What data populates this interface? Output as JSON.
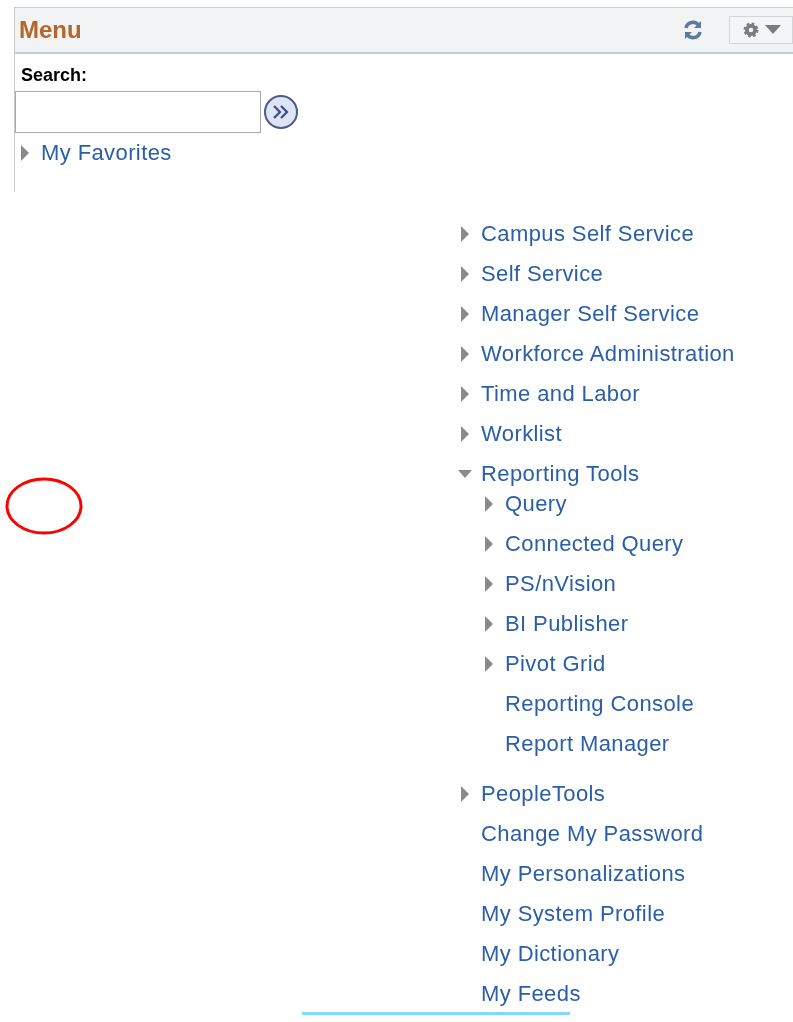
{
  "panel": {
    "title": "Menu"
  },
  "search": {
    "label": "Search:"
  },
  "favorites": {
    "label": "My Favorites",
    "kind": "folder",
    "expanded": false
  },
  "menu": [
    {
      "label": "Campus Self Service",
      "kind": "folder",
      "expanded": false
    },
    {
      "label": "Self Service",
      "kind": "folder",
      "expanded": false
    },
    {
      "label": "Manager Self Service",
      "kind": "folder",
      "expanded": false
    },
    {
      "label": "Workforce Administration",
      "kind": "folder",
      "expanded": false
    },
    {
      "label": "Time and Labor",
      "kind": "folder",
      "expanded": false
    },
    {
      "label": "Worklist",
      "kind": "folder",
      "expanded": false
    },
    {
      "label": "Reporting Tools",
      "kind": "folder",
      "expanded": true,
      "children": [
        {
          "label": "Query",
          "kind": "folder",
          "expanded": false
        },
        {
          "label": "Connected Query",
          "kind": "folder",
          "expanded": false
        },
        {
          "label": "PS/nVision",
          "kind": "folder",
          "expanded": false
        },
        {
          "label": "BI Publisher",
          "kind": "folder",
          "expanded": false
        },
        {
          "label": "Pivot Grid",
          "kind": "folder",
          "expanded": false
        },
        {
          "label": "Reporting Console",
          "kind": "link"
        },
        {
          "label": "Report Manager",
          "kind": "link"
        }
      ]
    },
    {
      "label": "PeopleTools",
      "kind": "folder",
      "expanded": false
    },
    {
      "label": "Change My Password",
      "kind": "link"
    },
    {
      "label": "My Personalizations",
      "kind": "link"
    },
    {
      "label": "My System Profile",
      "kind": "link"
    },
    {
      "label": "My Dictionary",
      "kind": "link"
    },
    {
      "label": "My Feeds",
      "kind": "link"
    }
  ]
}
